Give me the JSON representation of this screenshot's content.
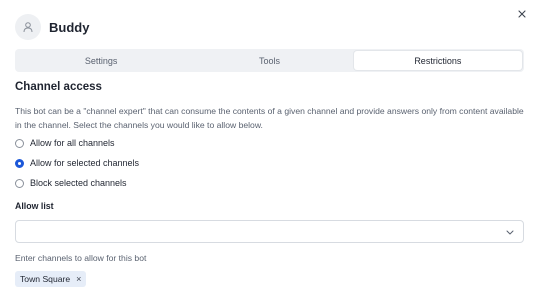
{
  "header": {
    "bot_name": "Buddy",
    "avatar_icon": "user-icon",
    "close_icon": "close-icon"
  },
  "tabs": [
    {
      "label": "Settings",
      "active": false
    },
    {
      "label": "Tools",
      "active": false
    },
    {
      "label": "Restrictions",
      "active": true
    }
  ],
  "channel_access": {
    "title": "Channel access",
    "description": "This bot can be a \"channel expert\" that can consume the contents of a given channel and provide answers only from content available in the channel. Select the channels you would like to allow below.",
    "options": [
      {
        "label": "Allow for all channels",
        "checked": false
      },
      {
        "label": "Allow for selected channels",
        "checked": true
      },
      {
        "label": "Block selected channels",
        "checked": false
      }
    ]
  },
  "allow_list": {
    "label": "Allow list",
    "value": "",
    "help": "Enter channels to allow for this bot",
    "chips": [
      {
        "label": "Town Square",
        "remove_glyph": "×"
      }
    ]
  },
  "colors": {
    "accent": "#1c58d9",
    "chip_bg": "#e6edf8",
    "tab_bg": "#eff1f4"
  }
}
